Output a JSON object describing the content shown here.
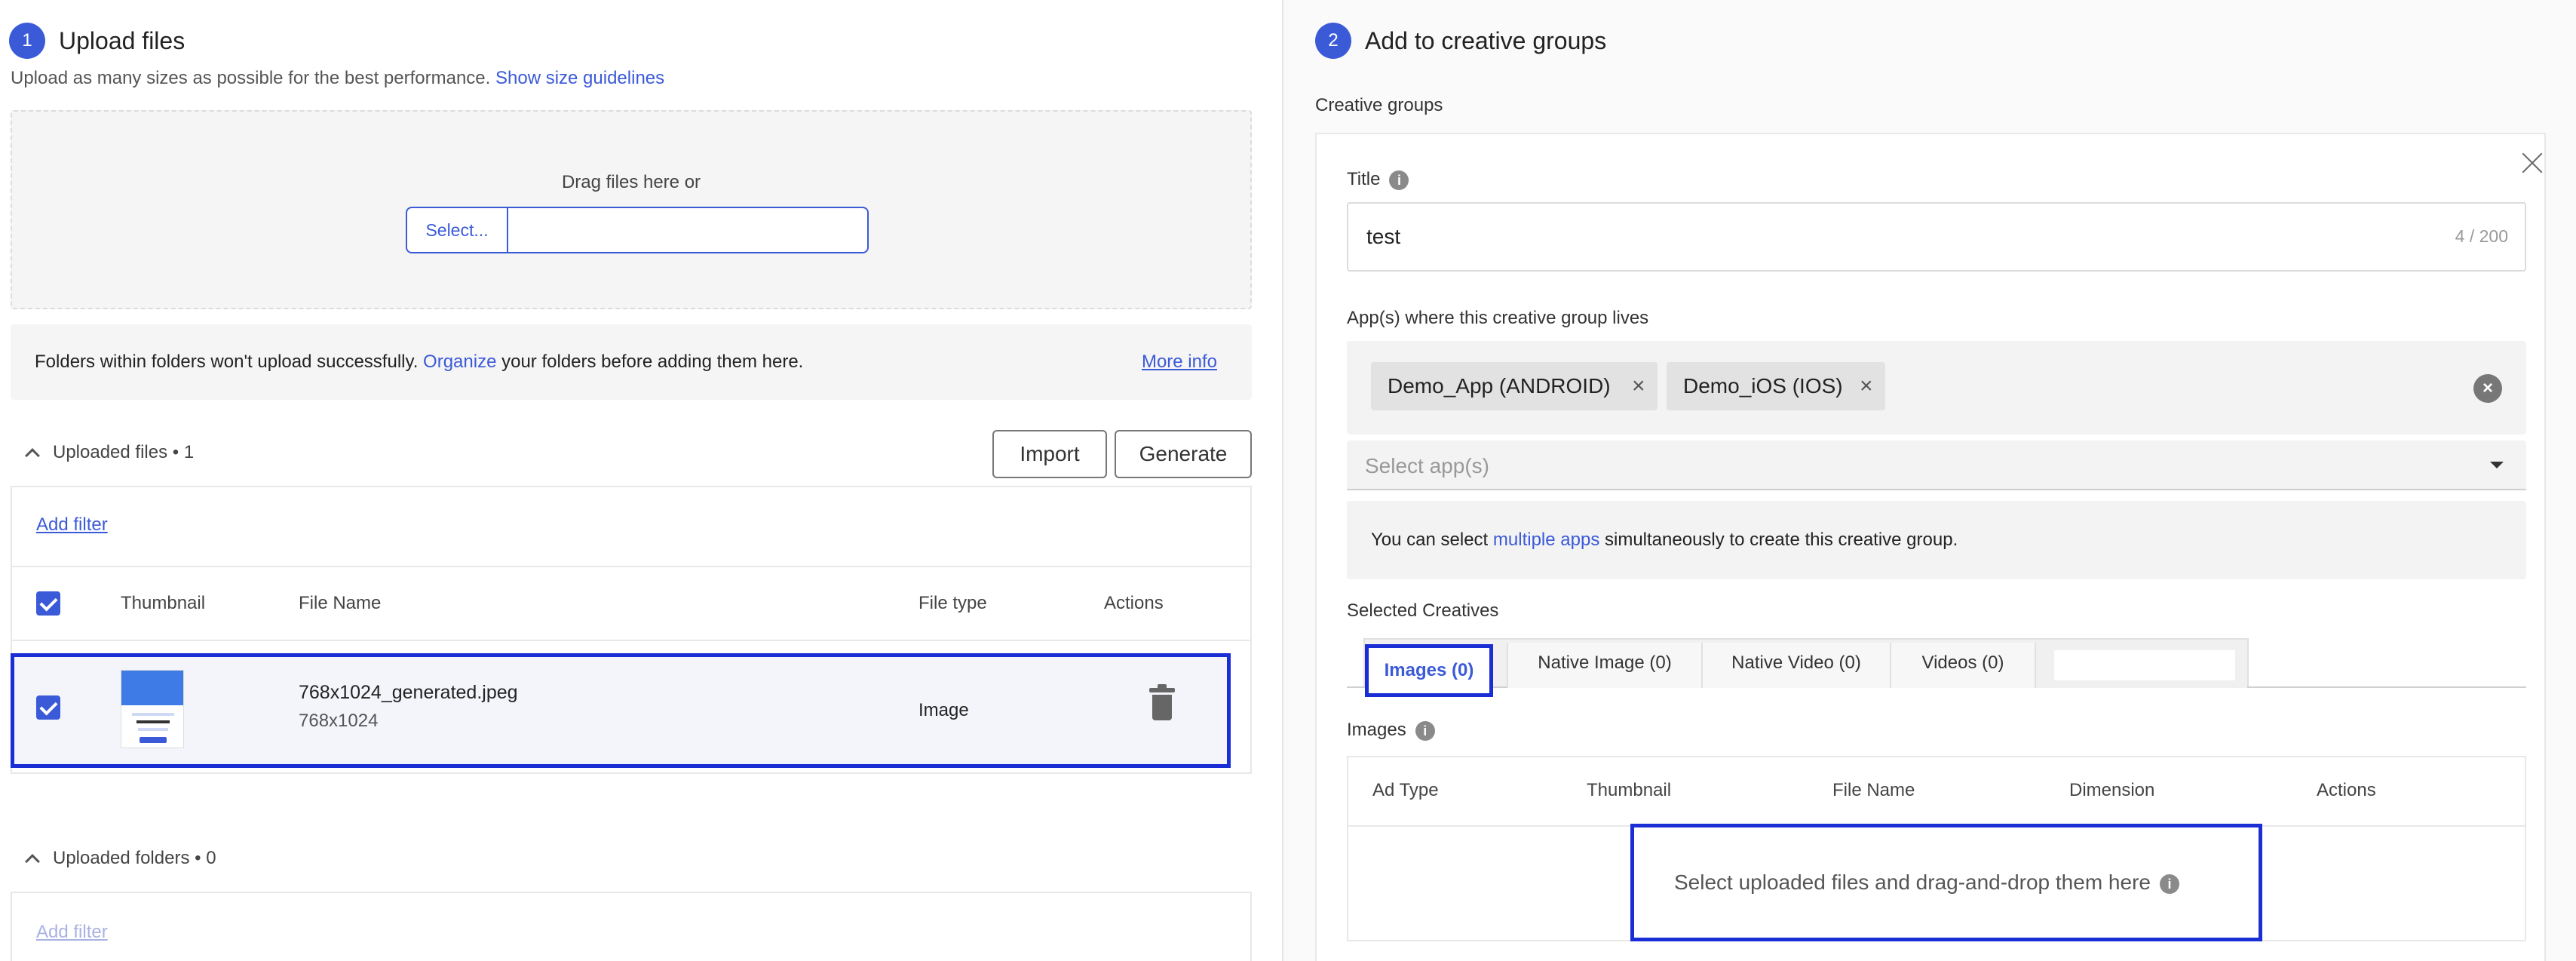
{
  "left": {
    "step": "1",
    "title": "Upload files",
    "subtitle": "Upload as many sizes as possible for the best performance.",
    "size_link": "Show size guidelines",
    "dropzone": {
      "text": "Drag files here or",
      "select_label": "Select...",
      "input_value": ""
    },
    "info": {
      "text_before": "Folders within folders won't upload successfully.",
      "link": "Organize",
      "text_after": "your folders before adding them here.",
      "more": "More info"
    },
    "uploaded": {
      "label": "Uploaded files • 1",
      "import_label": "Import",
      "generate_label": "Generate",
      "add_filter": "Add filter",
      "columns": [
        "Thumbnail",
        "File Name",
        "File type",
        "Actions"
      ],
      "rows": [
        {
          "file_name": "768x1024_generated.jpeg",
          "dimension": "768x1024",
          "file_type": "Image"
        }
      ]
    },
    "folders": {
      "label": "Uploaded folders • 0",
      "add_filter": "Add filter"
    }
  },
  "right": {
    "step": "2",
    "title": "Add to creative groups",
    "groups_label": "Creative groups",
    "title_label": "Title",
    "title_value": "test",
    "title_count": "4 / 200",
    "apps_label": "App(s) where this creative group lives",
    "chips": [
      "Demo_App (ANDROID)",
      "Demo_iOS (IOS)"
    ],
    "select_placeholder": "Select app(s)",
    "note": {
      "before": "You can select",
      "link": "multiple apps",
      "after": "simultaneously to create this creative group."
    },
    "selected_label": "Selected Creatives",
    "tabs": [
      "Images (0)",
      "Native Image (0)",
      "Native Video (0)",
      "Videos (0)"
    ],
    "images_label": "Images",
    "img_columns": [
      "Ad Type",
      "Thumbnail",
      "File Name",
      "Dimension",
      "Actions"
    ],
    "drop_text": "Select uploaded files and drag-and-drop them here"
  },
  "colors": {
    "accent": "#3b5ad8",
    "highlight": "#1a2ed6"
  }
}
